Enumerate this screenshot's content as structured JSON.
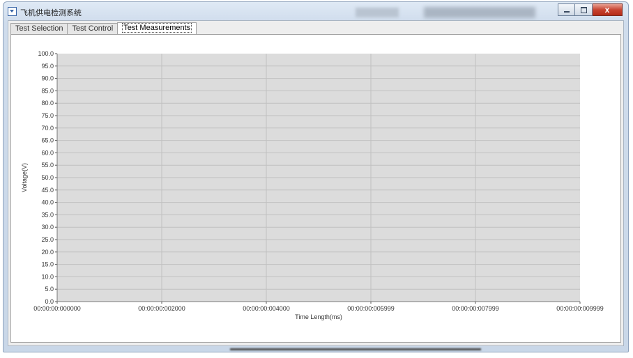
{
  "window": {
    "title": "飞机供电检测系统",
    "close_glyph": "x"
  },
  "tabs": [
    {
      "label": "Test Selection",
      "active": false
    },
    {
      "label": "Test Control",
      "active": false
    },
    {
      "label": "Test Measurements",
      "active": true
    }
  ],
  "colors": {
    "plot_background": "#dcdcdc",
    "gridline": "#c0c0c0",
    "accent": "#3a66a8"
  },
  "chart_data": {
    "type": "line",
    "title": "",
    "xlabel": "Time Length(ms)",
    "ylabel": "Voltage(V)",
    "ylim": [
      0,
      100
    ],
    "y_tick_labels": [
      "0.0",
      "5.0",
      "10.0",
      "15.0",
      "20.0",
      "25.0",
      "30.0",
      "35.0",
      "40.0",
      "45.0",
      "50.0",
      "55.0",
      "60.0",
      "65.0",
      "70.0",
      "75.0",
      "80.0",
      "85.0",
      "90.0",
      "95.0",
      "100.0"
    ],
    "x_tick_labels": [
      "00:00:00:000000",
      "00:00:00:002000",
      "00:00:00:004000",
      "00:00:00:005999",
      "00:00:00:007999",
      "00:00:00:009999"
    ],
    "series": [],
    "grid": true,
    "legend": "none"
  }
}
